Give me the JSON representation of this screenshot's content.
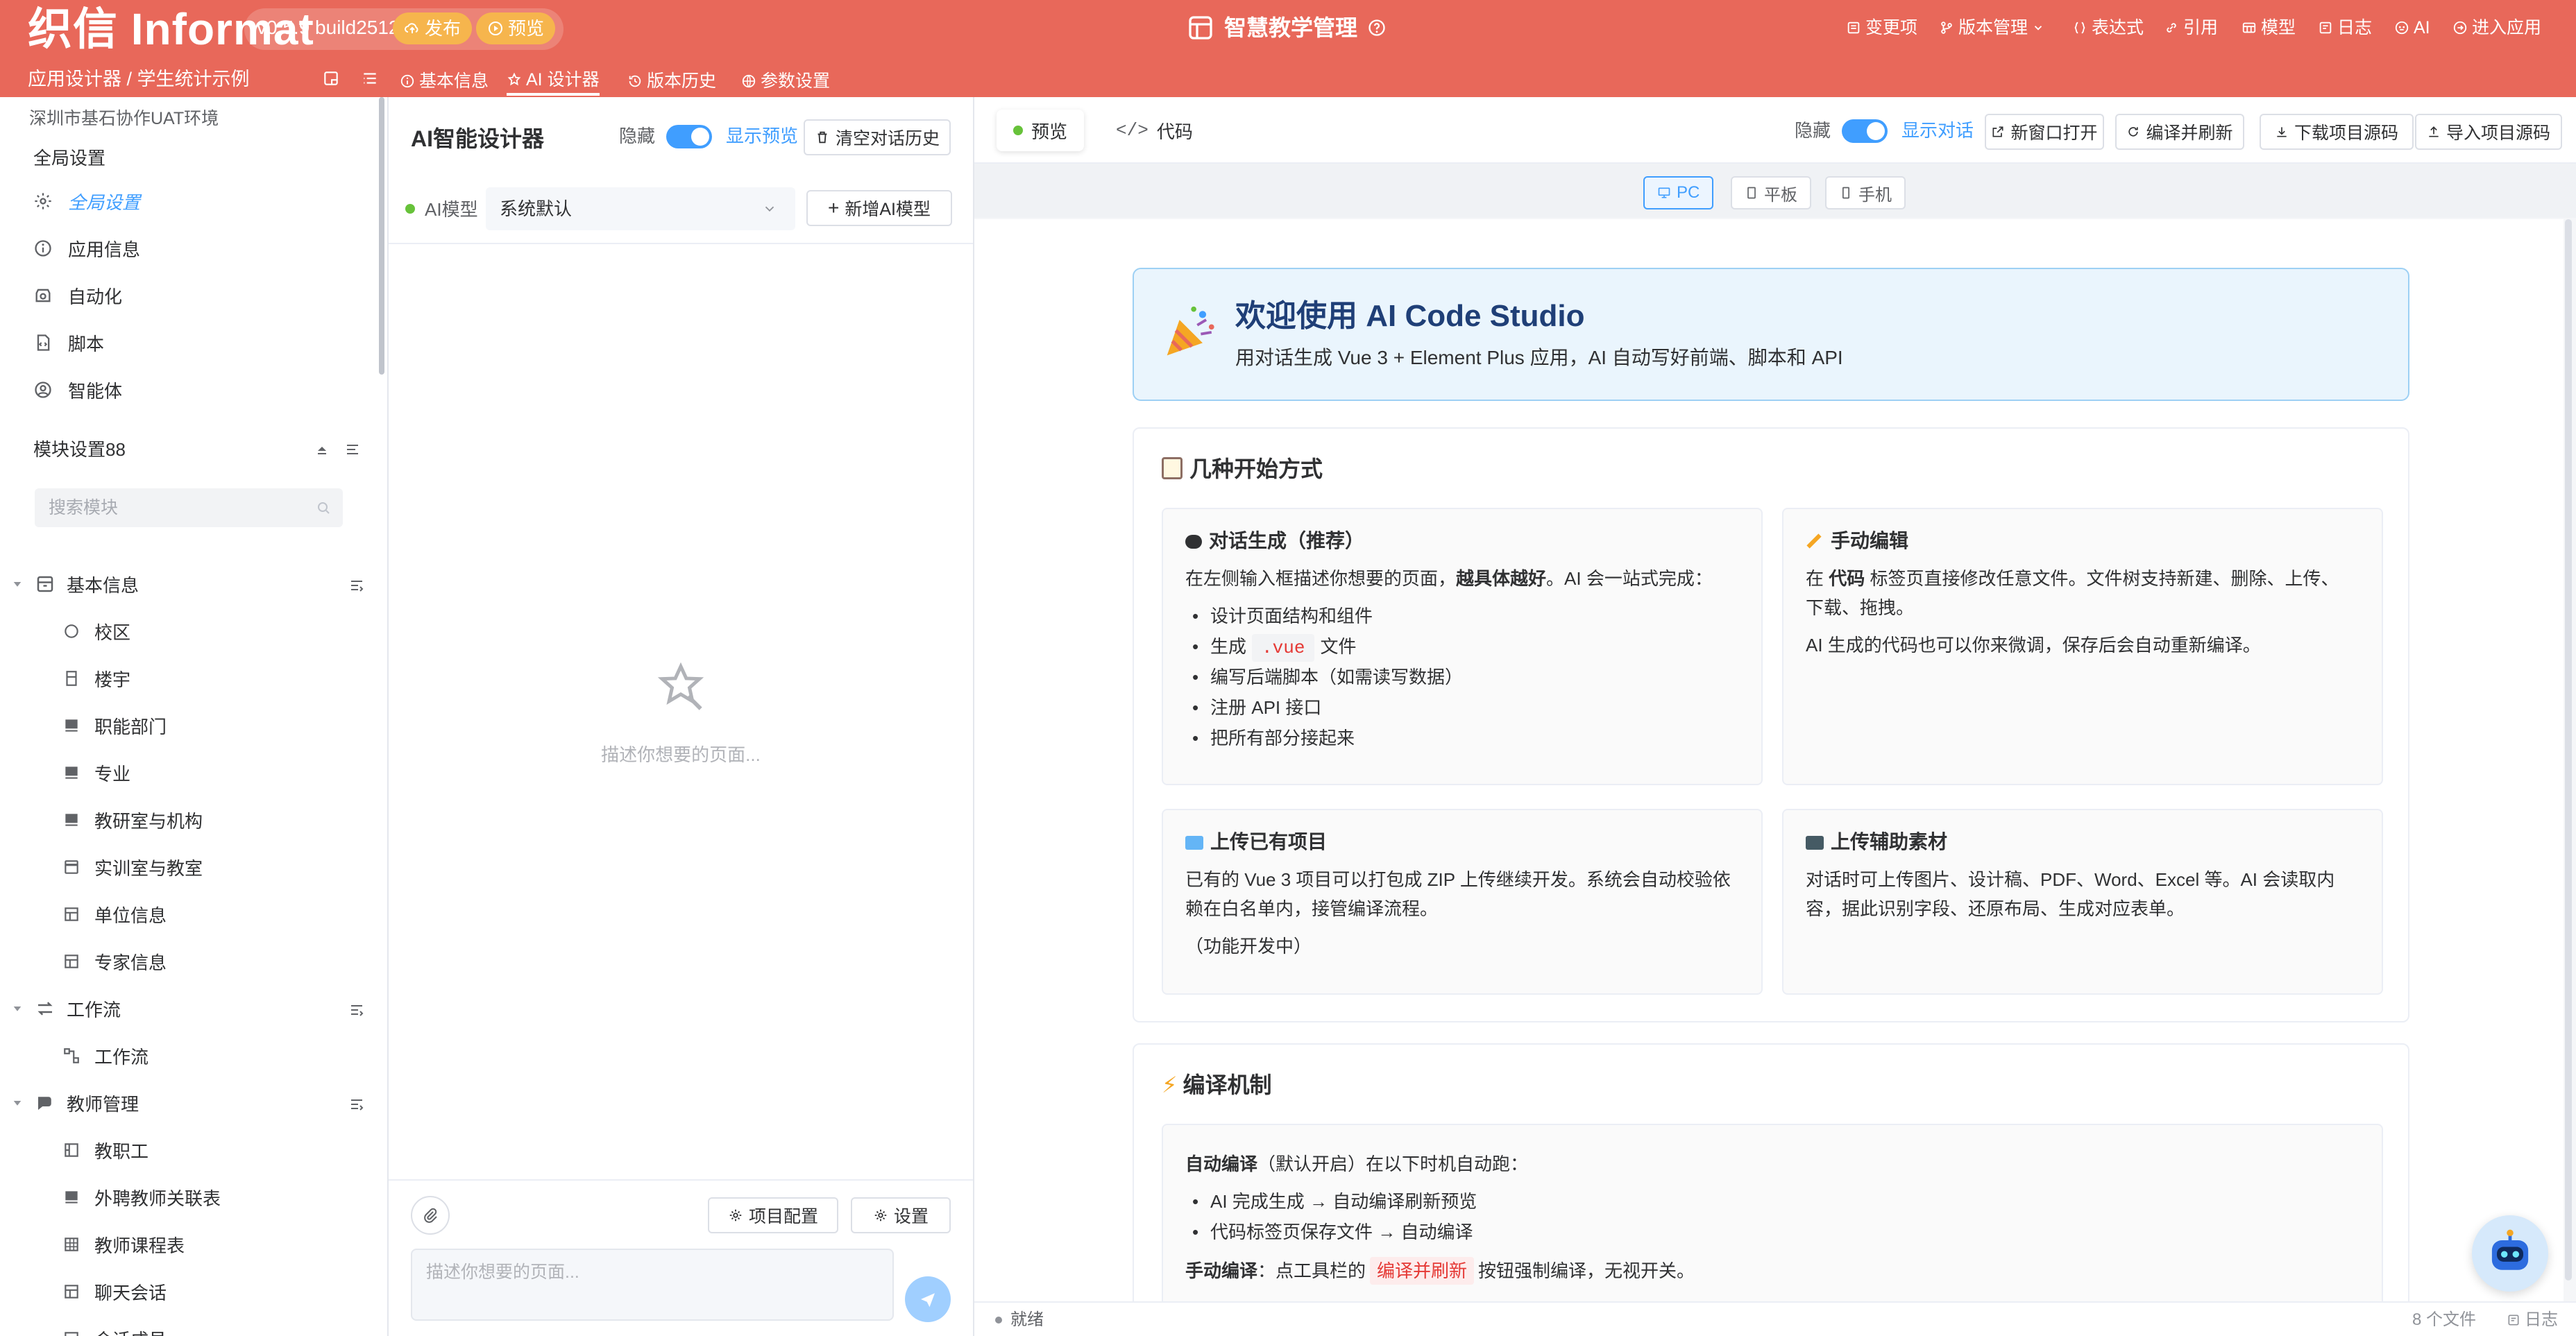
{
  "topbar": {
    "brand": "织信 Informat",
    "version": "v0.5.9 build2512",
    "publish_label": "发布",
    "preview_label": "预览",
    "page_title": "智慧教学管理",
    "menu": [
      "变更项",
      "版本管理",
      "表达式",
      "引用",
      "模型",
      "日志",
      "AI",
      "进入应用"
    ],
    "breadcrumb": "应用设计器 / 学生统计示例",
    "subtabs": [
      "基本信息",
      "AI 设计器",
      "版本历史",
      "参数设置"
    ]
  },
  "sidebar": {
    "environment": "深圳市基石协作UAT环境",
    "global_section": "全局设置",
    "global_items": [
      "全局设置",
      "应用信息",
      "自动化",
      "脚本",
      "智能体"
    ],
    "module_section": "模块设置88",
    "search_placeholder": "搜索模块",
    "groups": [
      {
        "label": "基本信息",
        "children": [
          "校区",
          "楼宇",
          "职能部门",
          "专业",
          "教研室与机构",
          "实训室与教室",
          "单位信息",
          "专家信息"
        ]
      },
      {
        "label": "工作流",
        "children": [
          "工作流"
        ]
      },
      {
        "label": "教师管理",
        "children": [
          "教职工",
          "外聘教师关联表",
          "教师课程表",
          "聊天会话",
          "会话成员"
        ]
      }
    ]
  },
  "ai_panel": {
    "title": "AI智能设计器",
    "hide_label": "隐藏",
    "show_preview_label": "显示预览",
    "clear_history_label": "清空对话历史",
    "model_label": "AI模型",
    "model_value": "系统默认",
    "add_model_label": "新增AI模型",
    "empty_hint": "描述你想要的页面...",
    "project_config_label": "项目配置",
    "settings_label": "设置",
    "input_placeholder": "描述你想要的页面..."
  },
  "preview": {
    "tabs": [
      "预览",
      "代码"
    ],
    "hide_label": "隐藏",
    "show_chat_label": "显示对话",
    "actions": [
      "新窗口打开",
      "编译并刷新",
      "下载项目源码",
      "导入项目源码"
    ],
    "devices": [
      "PC",
      "平板",
      "手机"
    ],
    "welcome_title": "欢迎使用 AI Code Studio",
    "welcome_sub": "用对话生成 Vue 3 + Element Plus 应用，AI 自动写好前端、脚本和 API",
    "start_title": "几种开始方式",
    "cards": {
      "chat": {
        "title": "对话生成（推荐）",
        "intro_a": "在左侧输入框描述你想要的页面，",
        "intro_b": "越具体越好",
        "intro_c": "。AI 会一站式完成：",
        "bullets": [
          "设计页面结构和组件",
          "编写后端脚本（如需读写数据）",
          "注册 API 接口",
          "把所有部分接起来"
        ],
        "vue_prefix": "生成",
        "vue_code": ".vue",
        "vue_suffix": "文件"
      },
      "manual": {
        "title": "手动编辑",
        "line1_a": "在",
        "line1_b": "代码",
        "line1_c": "标签页直接修改任意文件。文件树支持新建、删除、上传、",
        "line2": "下载、拖拽。",
        "line3": "AI 生成的代码也可以你来微调，保存后会自动重新编译。"
      },
      "upload": {
        "title": "上传已有项目",
        "line1": "已有的 Vue 3 项目可以打包成 ZIP 上传继续开发。系统会自动校验依",
        "line2": "赖在白名单内，接管编译流程。",
        "line3": "（功能开发中）"
      },
      "assets": {
        "title": "上传辅助素材",
        "line1": "对话时可上传图片、设计稿、PDF、Word、Excel 等。AI 会读取内",
        "line2": "容，据此识别字段、还原布局、生成对应表单。"
      }
    },
    "compile_title": "编译机制",
    "compile": {
      "auto_bold": "自动编译",
      "auto_rest": "（默认开启）在以下时机自动跑：",
      "bullets": [
        "AI 完成生成 → 自动编译刷新预览",
        "代码标签页保存文件 → 自动编译"
      ],
      "manual_bold": "手动编译",
      "manual_a": "：点工具栏的",
      "manual_btn": "编译并刷新",
      "manual_b": "按钮强制编译，无视开关。"
    }
  },
  "statusbar": {
    "status": "就绪",
    "file_count": "8 个文件",
    "log_label": "日志"
  },
  "colors": {
    "topbar": "#e8685a",
    "accent": "#409eff",
    "pill": "#f6b54d",
    "success": "#67c23a"
  }
}
